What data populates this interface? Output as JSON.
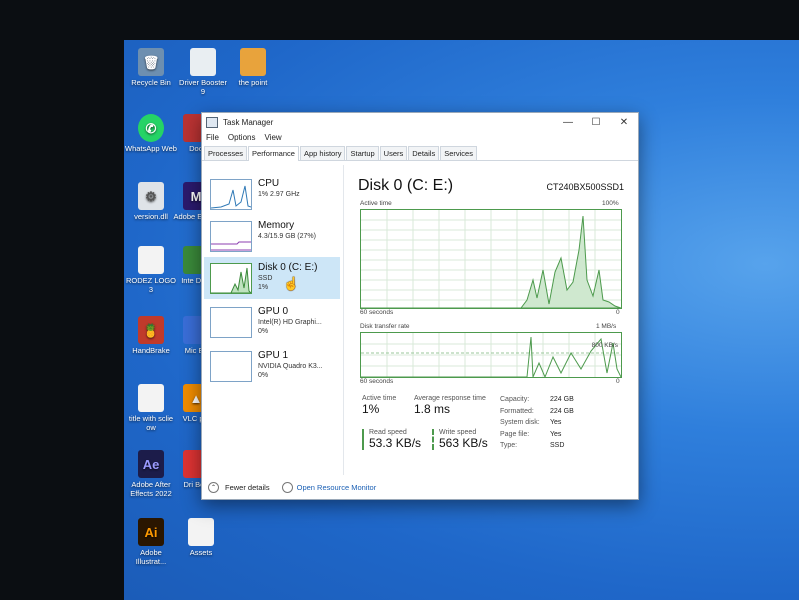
{
  "desktop": {
    "icons": [
      {
        "label": "Recycle Bin",
        "glyph": "🗑",
        "color": "#6d8fb0"
      },
      {
        "label": "Driver Booster 9",
        "glyph": "",
        "color": "#e9eef2"
      },
      {
        "label": "the point",
        "glyph": "",
        "color": "#e8a33c"
      },
      {
        "label": "WhatsApp Web",
        "glyph": "✆",
        "color": "#25d366"
      },
      {
        "label": "Doo",
        "glyph": "",
        "color": "#b33"
      },
      {
        "label": "version.dll",
        "glyph": "⚙",
        "color": "#dfe3e8"
      },
      {
        "label": "Adobe Encod",
        "glyph": "M",
        "color": "#2b1a6e"
      },
      {
        "label": "RODEZ LOGO 3",
        "glyph": "",
        "color": "#f3f3f3"
      },
      {
        "label": "Inte Dow",
        "glyph": "",
        "color": "#3a8a3a"
      },
      {
        "label": "HandBrake",
        "glyph": "🍍",
        "color": "#c03a2b"
      },
      {
        "label": "Mic Ec",
        "glyph": "",
        "color": "#3a6ed8"
      },
      {
        "label": "title with sclie ow",
        "glyph": "",
        "color": "#f3f3f3"
      },
      {
        "label": "VLC pla",
        "glyph": "▲",
        "color": "#f08c00"
      },
      {
        "label": "Adobe After Effects 2022",
        "glyph": "Ae",
        "color": "#1c1c4a"
      },
      {
        "label": "Dri Boo",
        "glyph": "",
        "color": "#d33"
      },
      {
        "label": "Adobe Illustrat...",
        "glyph": "Ai",
        "color": "#2a1600"
      },
      {
        "label": "Assets",
        "glyph": "",
        "color": "#f3f3f3"
      }
    ]
  },
  "window": {
    "title": "Task Manager",
    "controls": {
      "minimize": "—",
      "maximize": "☐",
      "close": "✕"
    },
    "menu": [
      "File",
      "Options",
      "View"
    ],
    "tabs": [
      "Processes",
      "Performance",
      "App history",
      "Startup",
      "Users",
      "Details",
      "Services"
    ],
    "active_tab": "Performance"
  },
  "sidebar": {
    "items": [
      {
        "name": "CPU",
        "sub": "1% 2.97 GHz",
        "sub2": ""
      },
      {
        "name": "Memory",
        "sub": "4.3/15.9 GB (27%)",
        "sub2": ""
      },
      {
        "name": "Disk 0 (C: E:)",
        "sub": "SSD",
        "sub2": "1%"
      },
      {
        "name": "GPU 0",
        "sub": "Intel(R) HD Graphi...",
        "sub2": "0%"
      },
      {
        "name": "GPU 1",
        "sub": "NVIDIA Quadro K3...",
        "sub2": "0%"
      }
    ]
  },
  "main": {
    "title": "Disk 0 (C: E:)",
    "model": "CT240BX500SSD1",
    "chart1": {
      "label": "Active time",
      "max": "100%",
      "x_label": "60 seconds",
      "min": "0"
    },
    "chart2": {
      "label": "Disk transfer rate",
      "max": "1 MB/s",
      "mid": "800 KB/s",
      "x_label": "60 seconds",
      "min": "0"
    },
    "stats": {
      "active_time_label": "Active time",
      "active_time_value": "1%",
      "avg_response_label": "Average response time",
      "avg_response_value": "1.8 ms",
      "read_speed_label": "Read speed",
      "read_speed_value": "53.3 KB/s",
      "write_speed_label": "Write speed",
      "write_speed_value": "563 KB/s",
      "capacity_label": "Capacity:",
      "capacity_value": "224 GB",
      "formatted_label": "Formatted:",
      "formatted_value": "224 GB",
      "system_disk_label": "System disk:",
      "system_disk_value": "Yes",
      "page_file_label": "Page file:",
      "page_file_value": "Yes",
      "type_label": "Type:",
      "type_value": "SSD"
    }
  },
  "footer": {
    "fewer_details": "Fewer details",
    "open_monitor": "Open Resource Monitor"
  }
}
